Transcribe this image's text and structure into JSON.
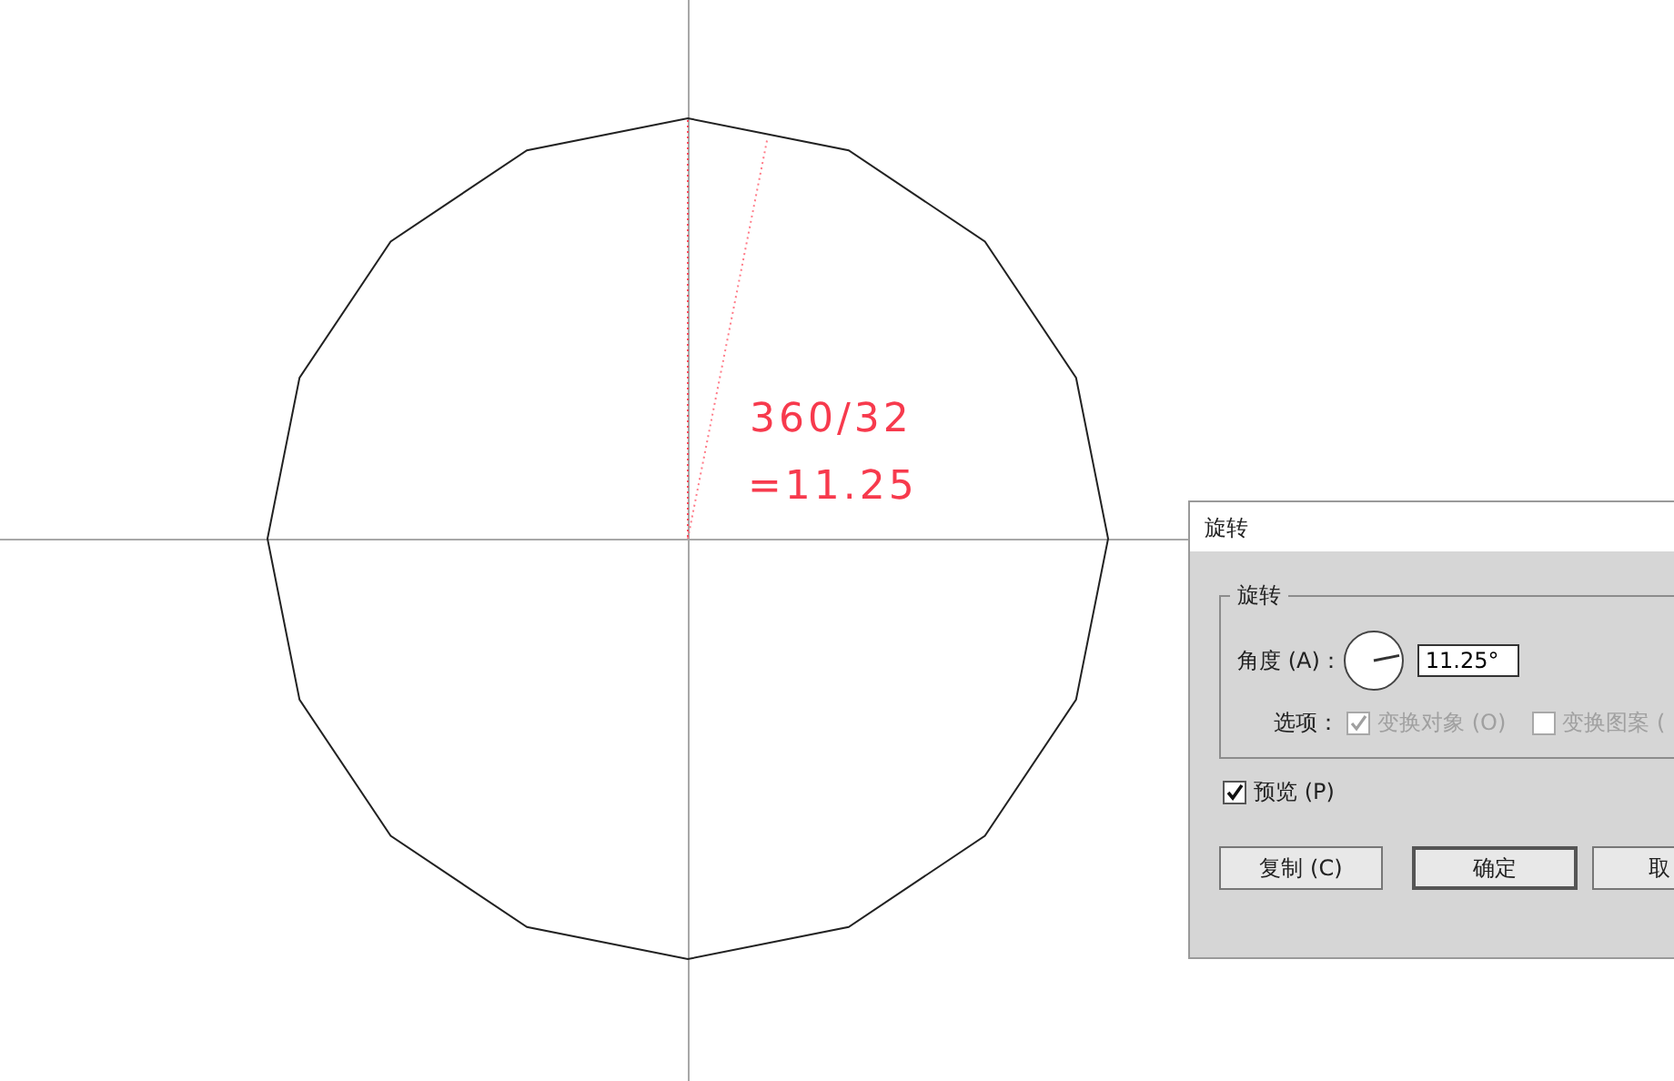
{
  "canvas": {
    "annotation": [
      "360/32",
      "=11.25"
    ]
  },
  "dialog": {
    "title": "旋转",
    "group_title": "旋转",
    "angle_label": "角度 (A)：",
    "angle_value": "11.25°",
    "options_label": "选项：",
    "options": [
      {
        "label": "变换对象 (O)",
        "checked": true,
        "disabled": true
      },
      {
        "label": "变换图案 (",
        "checked": false,
        "disabled": true
      }
    ],
    "preview": {
      "label": "预览 (P)",
      "checked": true
    },
    "buttons": [
      {
        "label": "复制 (C)",
        "default": false
      },
      {
        "label": "确定",
        "default": true
      },
      {
        "label": "取",
        "default": false
      }
    ]
  }
}
